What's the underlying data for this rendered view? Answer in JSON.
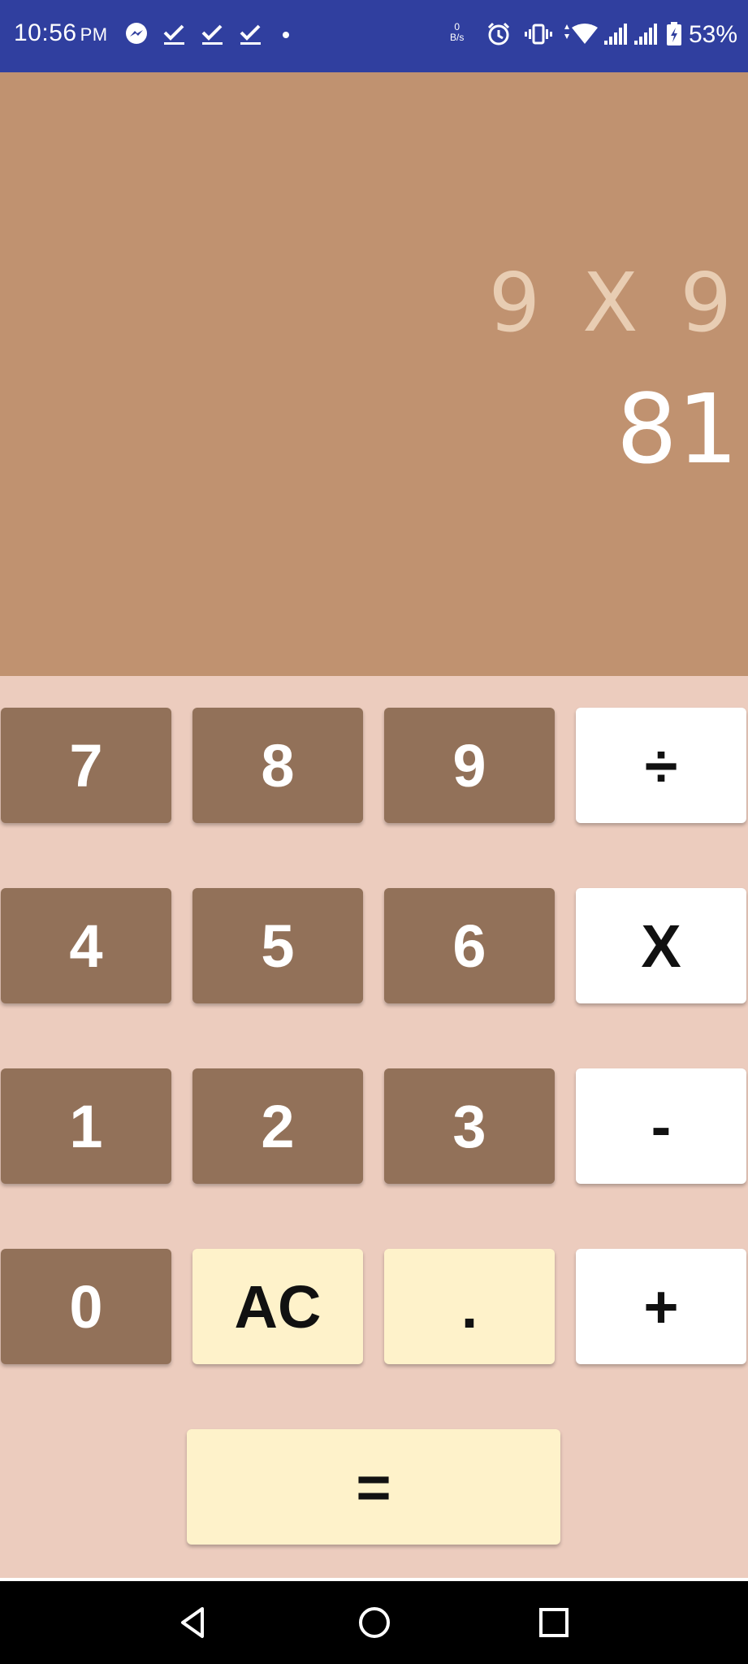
{
  "status_bar": {
    "time": "10:56",
    "ampm": "PM",
    "net_speed_value": "0",
    "net_speed_unit": "B/s",
    "battery_percent": "53%",
    "icons": [
      "messenger-icon",
      "check-icon",
      "check-icon",
      "check-icon",
      "dot-icon",
      "alarm-icon",
      "vibrate-icon",
      "wifi-icon",
      "signal-icon",
      "signal-icon",
      "battery-charging-icon"
    ],
    "color": "#303f9f"
  },
  "display": {
    "expression": "9 X 9",
    "result": "81",
    "background": "#c09270"
  },
  "keypad": {
    "rows": [
      [
        "7",
        "8",
        "9",
        "÷"
      ],
      [
        "4",
        "5",
        "6",
        "X"
      ],
      [
        "1",
        "2",
        "3",
        "-"
      ],
      [
        "0",
        "AC",
        ".",
        "+"
      ]
    ],
    "equals": "=",
    "colors": {
      "number_key": "#927159",
      "operator_key": "#ffffff",
      "special_key": "#fef2ca",
      "background": "#ecccbe"
    }
  },
  "nav_bar": {
    "buttons": [
      "back-icon",
      "home-icon",
      "recents-icon"
    ]
  }
}
